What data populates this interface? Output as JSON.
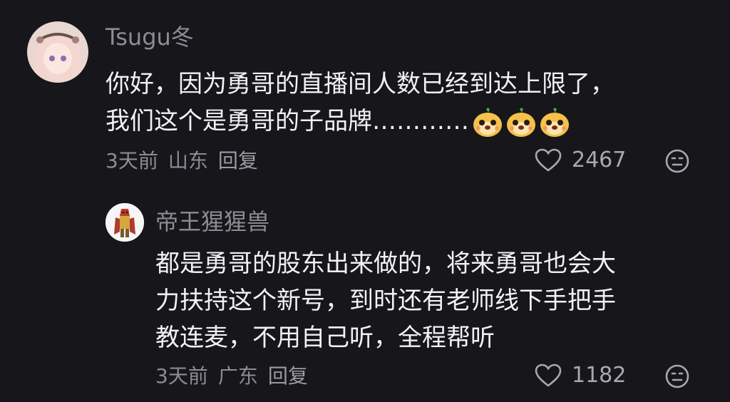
{
  "comments": [
    {
      "username": "Tsugu冬",
      "lines": [
        "你好，因为勇哥的直播间人数已经到达上限了，",
        "我们这个是勇哥的子品牌…………"
      ],
      "emoji": [
        "dog-face-emoji",
        "dog-face-emoji",
        "dog-face-emoji"
      ],
      "time": "3天前",
      "location": "山东",
      "reply_label": "回复",
      "likes": "2467",
      "avatar_icon": "anime-girl-avatar"
    },
    {
      "username": "帝王猩猩兽",
      "lines": [
        "都是勇哥的股东出来做的，将来勇哥也会大",
        "力扶持这个新号，到时还有老师线下手把手",
        "教连麦，不用自己听，全程帮听"
      ],
      "time": "3天前",
      "location": "广东",
      "reply_label": "回复",
      "likes": "1182",
      "avatar_icon": "digimon-avatar"
    }
  ],
  "colors": {
    "background": "#17161b",
    "text": "#f2f2f4",
    "muted": "#8d8c92"
  }
}
